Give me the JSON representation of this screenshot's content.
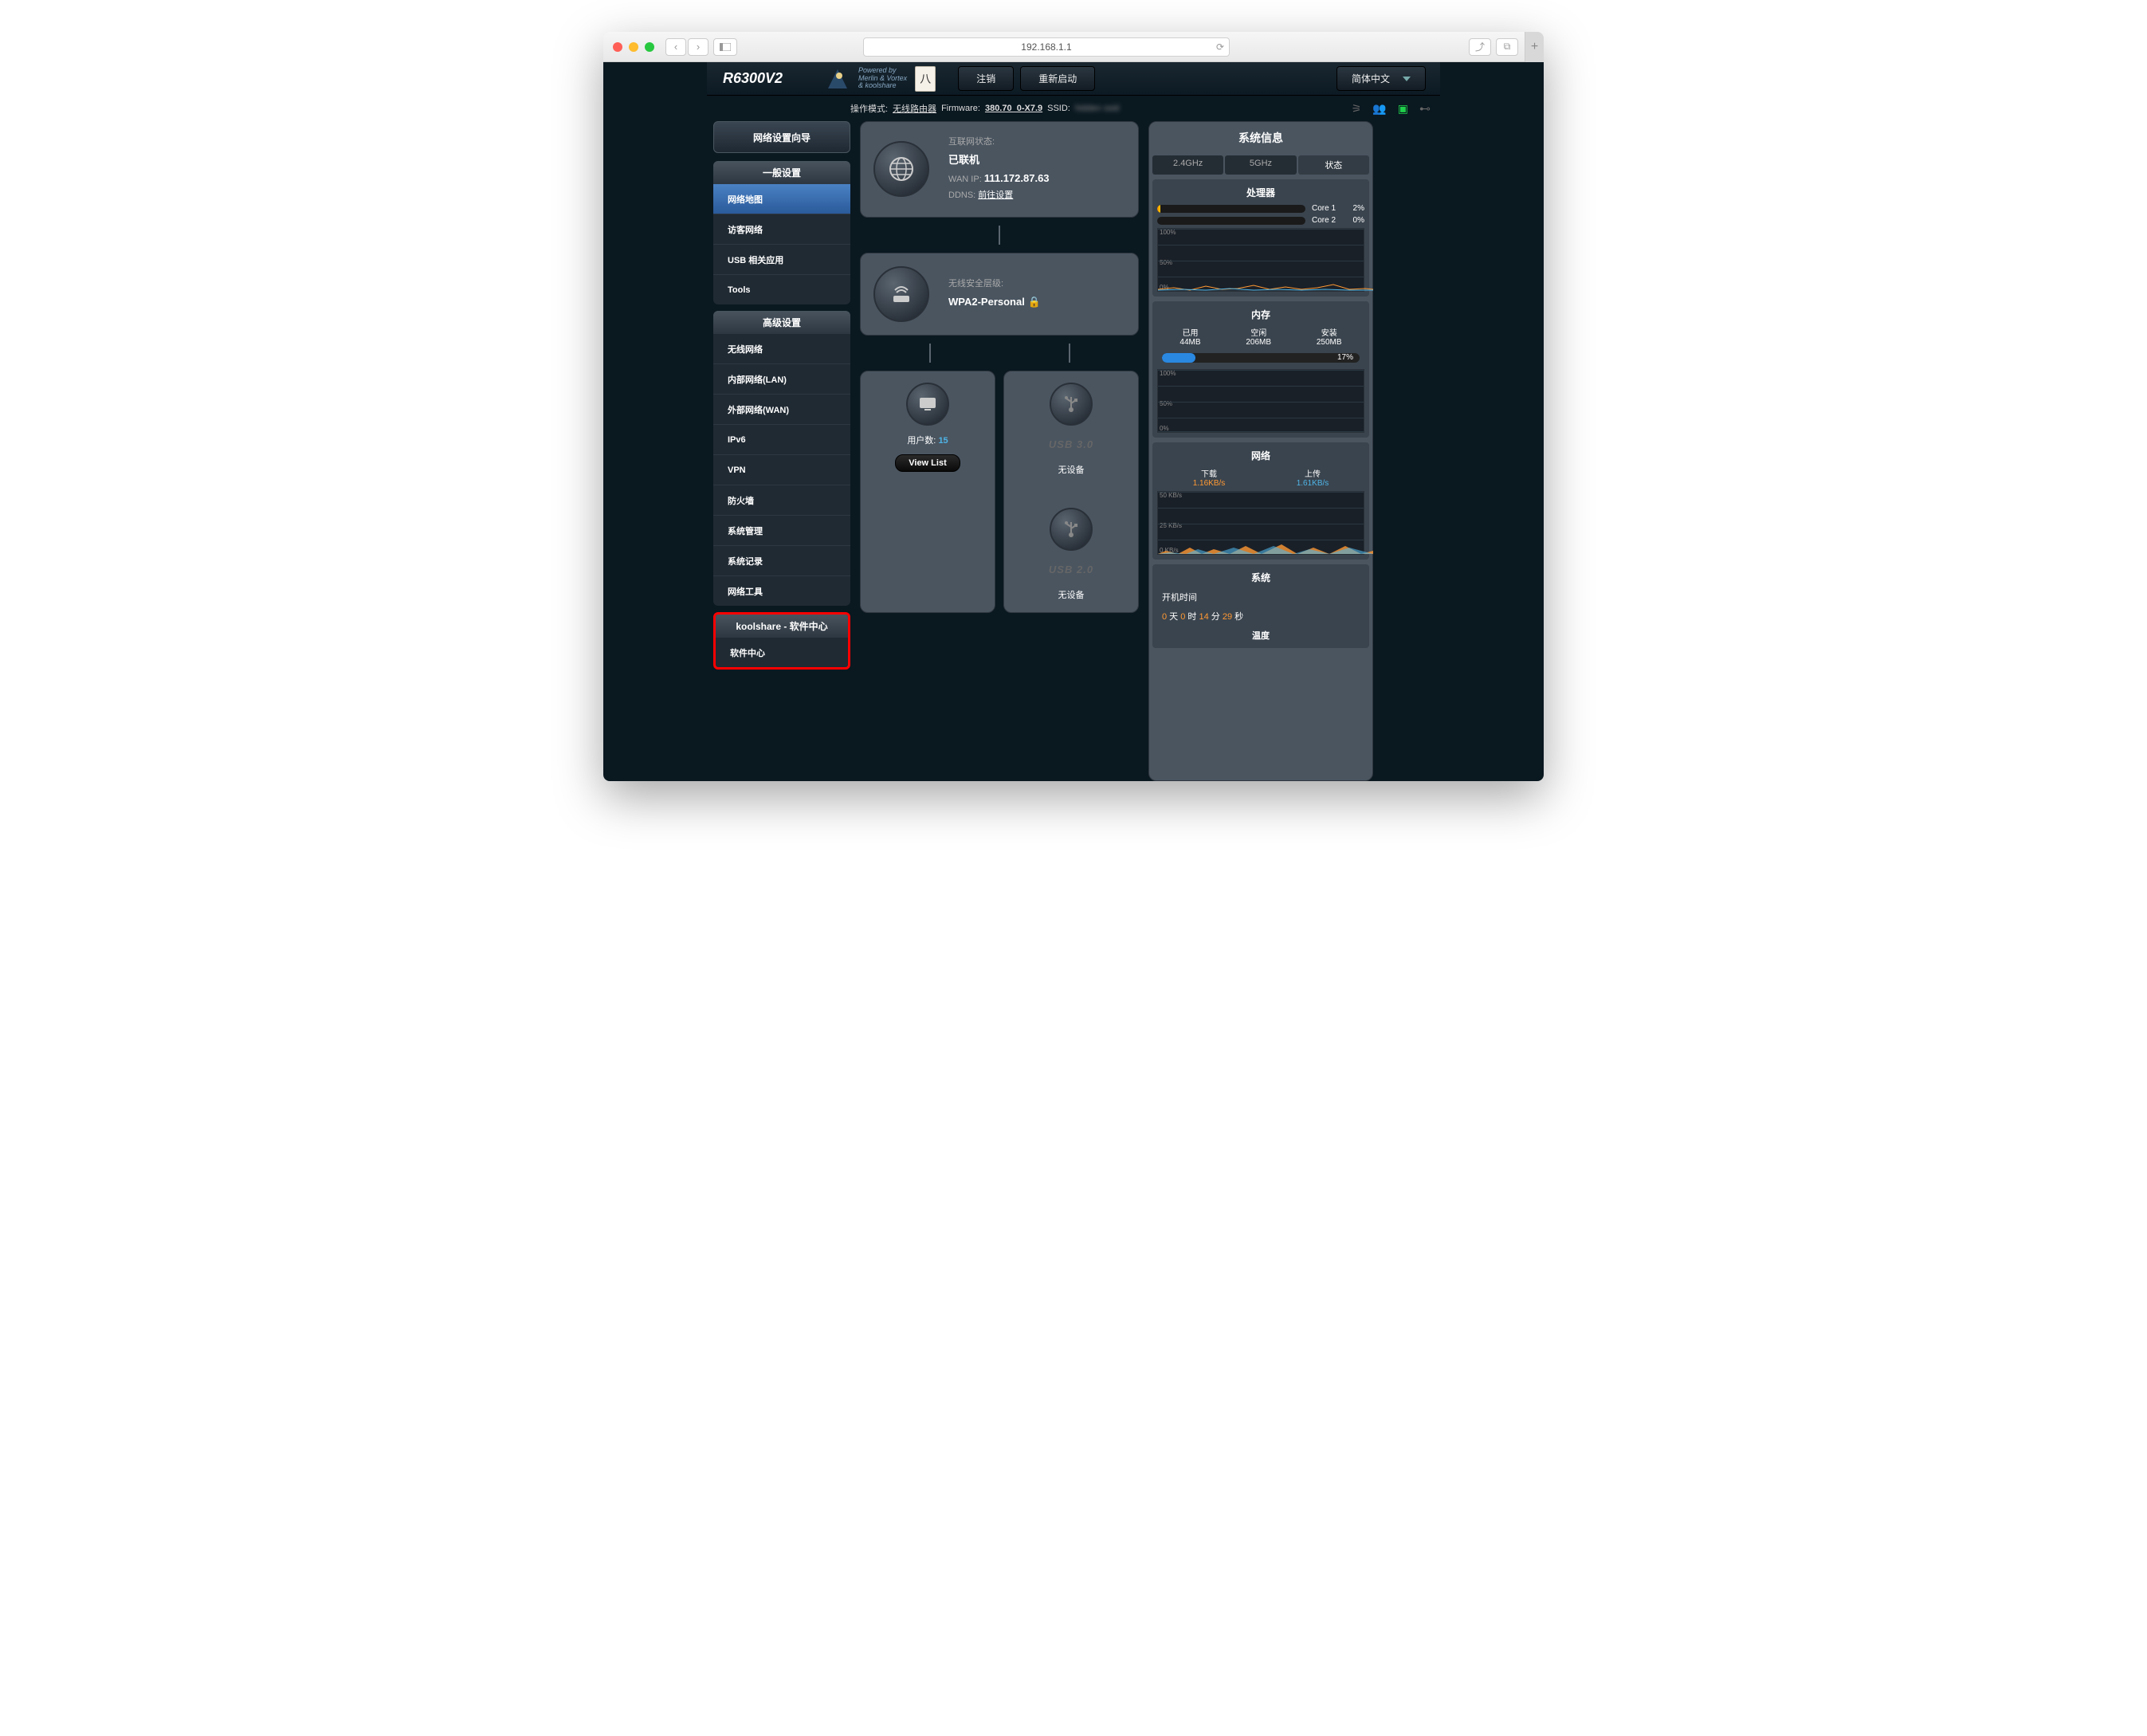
{
  "browser": {
    "url": "192.168.1.1"
  },
  "header": {
    "model": "R6300V2",
    "powered_l1": "Powered by",
    "powered_l2": "Merlin & Vortex",
    "powered_l3": "& koolshare",
    "logout": "注销",
    "reboot": "重新启动",
    "language": "简体中文"
  },
  "info": {
    "mode_l": "操作模式:",
    "mode_v": "无线路由器",
    "fw_l": "Firmware:",
    "fw_v": "380.70_0-X7.9",
    "ssid_l": "SSID:"
  },
  "sidebar": {
    "wizard": "网络设置向导",
    "sec1": "一般设置",
    "items1": [
      "网络地图",
      "访客网络",
      "USB 相关应用",
      "Tools"
    ],
    "sec2": "高级设置",
    "items2": [
      "无线网络",
      "内部网络(LAN)",
      "外部网络(WAN)",
      "IPv6",
      "VPN",
      "防火墙",
      "系统管理",
      "系统记录",
      "网络工具"
    ],
    "sec3": "koolshare - 软件中心",
    "items3": [
      "软件中心"
    ]
  },
  "internet": {
    "status_l": "互联网状态:",
    "status_v": "已联机",
    "wan_l": "WAN IP:",
    "wan_v": "111.172.87.63",
    "ddns_l": "DDNS:",
    "ddns_v": "前往设置"
  },
  "wifi": {
    "sec_l": "无线安全层级:",
    "sec_v": "WPA2-Personal"
  },
  "clients": {
    "label": "用户数:",
    "count": "15",
    "viewlist": "View List",
    "nodev": "无设备"
  },
  "usb": {
    "usb30": "USB 3.0",
    "usb20": "USB 2.0",
    "nodev": "无设备"
  },
  "sys": {
    "title": "系统信息",
    "tab24": "2.4GHz",
    "tab5": "5GHz",
    "tabst": "状态",
    "cpu": "处理器",
    "core1": "Core 1",
    "core2": "Core 2",
    "c1p": "2%",
    "c2p": "0%",
    "mem": "内存",
    "used_l": "已用",
    "free_l": "空闲",
    "inst_l": "安装",
    "used_v": "44MB",
    "free_v": "206MB",
    "inst_v": "250MB",
    "mem_pct": "17%",
    "net": "网络",
    "dl_l": "下载",
    "ul_l": "上传",
    "dl_v": "1.16KB/s",
    "ul_v": "1.61KB/s",
    "syst": "系统",
    "uptime_l": "开机时间",
    "up_d": "0",
    "up_dl": " 天 ",
    "up_h": "0",
    "up_hl": " 时 ",
    "up_m": "14",
    "up_ml": " 分 ",
    "up_s": "29",
    "up_sl": " 秒",
    "temp": "温度"
  }
}
